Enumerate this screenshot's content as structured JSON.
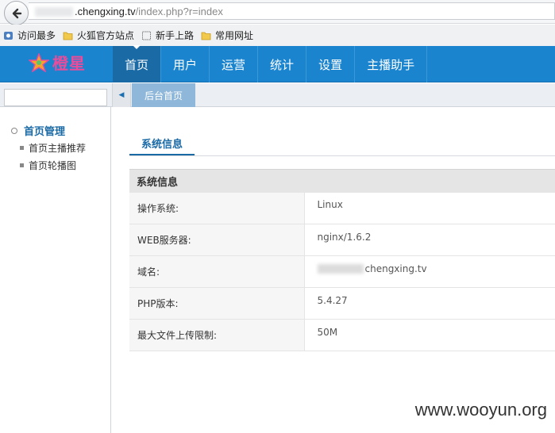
{
  "browser": {
    "url_host": ".chengxing.tv",
    "url_rest": "/index.php?r=index"
  },
  "bookmarks": [
    {
      "label": "访问最多",
      "icon": "gear-icon"
    },
    {
      "label": "火狐官方站点",
      "icon": "folder-icon"
    },
    {
      "label": "新手上路",
      "icon": "page-icon"
    },
    {
      "label": "常用网址",
      "icon": "folder-icon"
    }
  ],
  "header": {
    "logo_text": "橙星",
    "nav": [
      {
        "label": "首页",
        "active": true
      },
      {
        "label": "用户"
      },
      {
        "label": "运营"
      },
      {
        "label": "统计"
      },
      {
        "label": "设置"
      },
      {
        "label": "主播助手"
      }
    ]
  },
  "subbar": {
    "search_placeholder": "",
    "collapse_glyph": "◀",
    "tab": "后台首页"
  },
  "sidebar": {
    "group": "首页管理",
    "items": [
      "首页主播推荐",
      "首页轮播图"
    ]
  },
  "main": {
    "tab": "系统信息",
    "table_header": "系统信息",
    "rows": [
      {
        "label": "操作系统:",
        "value": "Linux"
      },
      {
        "label": "WEB服务器:",
        "value": "nginx/1.6.2"
      },
      {
        "label": "域名:",
        "value": "chengxing.tv",
        "blur_prefix": true
      },
      {
        "label": "PHP版本:",
        "value": "5.4.27"
      },
      {
        "label": "最大文件上传限制:",
        "value": "50M"
      }
    ]
  },
  "watermark": "www.wooyun.org",
  "colors": {
    "header_blue": "#1b84cf",
    "active_nav": "#1a6aa6",
    "logo_pink": "#e84c9a"
  }
}
